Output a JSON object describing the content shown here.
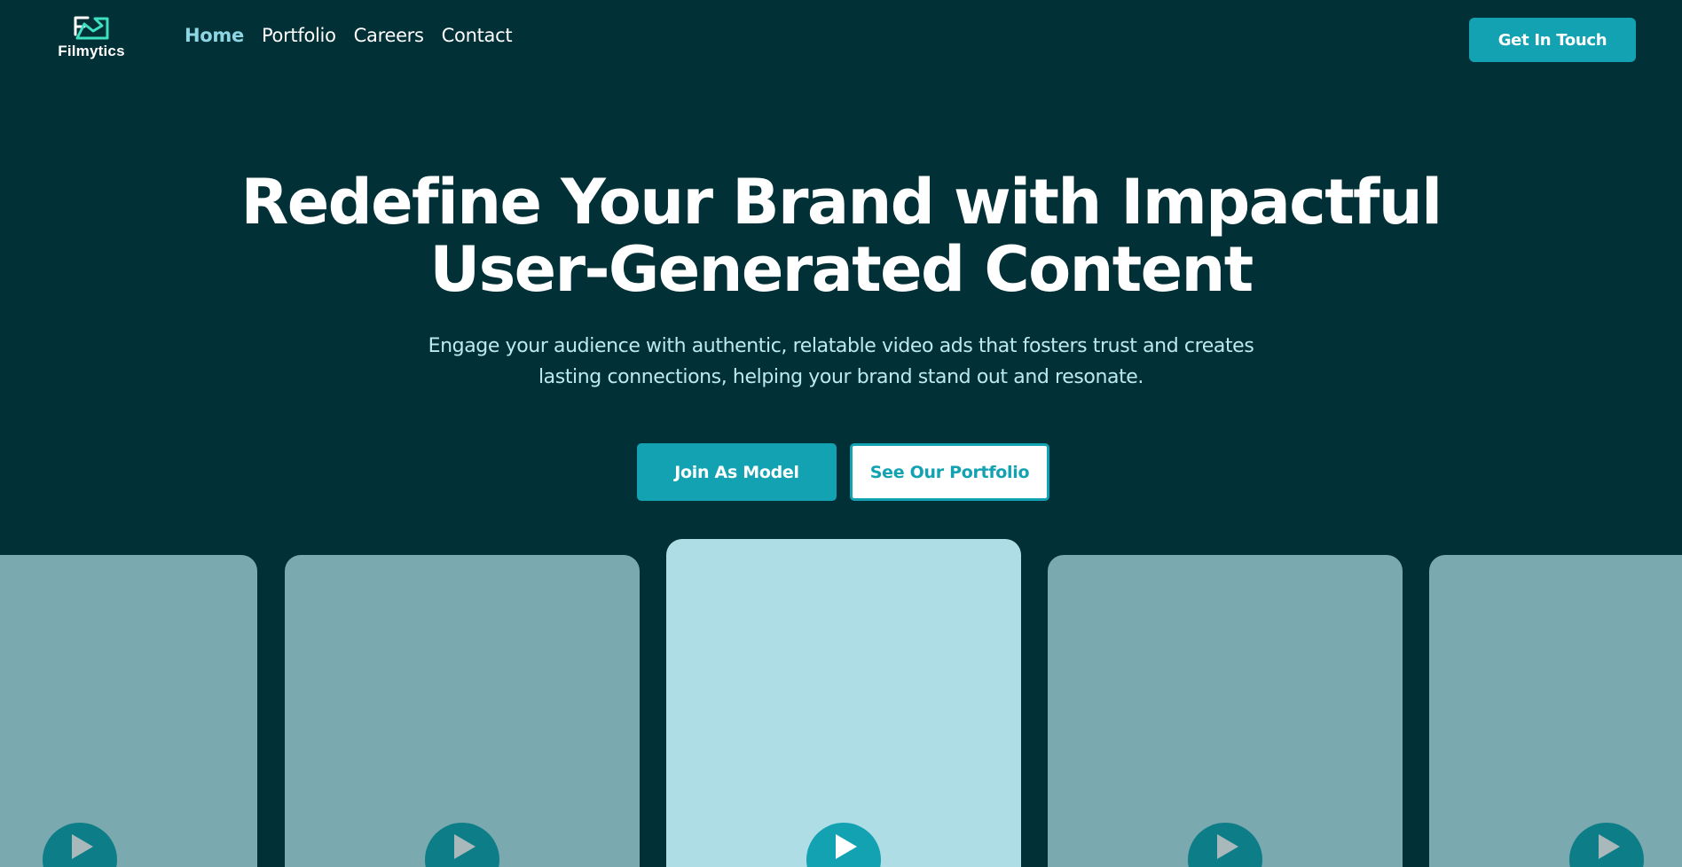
{
  "brand": {
    "name": "Filmytics",
    "logo_icon": "filmytics-logo-icon",
    "accent_color": "#12a2b1",
    "background_color": "#013036"
  },
  "nav": {
    "items": [
      {
        "label": "Home",
        "active": true
      },
      {
        "label": "Portfolio",
        "active": false
      },
      {
        "label": "Careers",
        "active": false
      },
      {
        "label": "Contact",
        "active": false
      }
    ],
    "cta_label": "Get In Touch"
  },
  "hero": {
    "title_line1": "Redefine Your Brand with Impactful",
    "title_line2": "User-Generated Content",
    "subtitle_line1": "Engage your audience with authentic, relatable video ads that fosters trust and creates",
    "subtitle_line2": "lasting connections, helping your brand stand out and resonate.",
    "primary_button": "Join As Model",
    "secondary_button": "See Our Portfolio"
  },
  "videos": {
    "play_icon": "play-icon",
    "cards": [
      {
        "highlighted": false
      },
      {
        "highlighted": false
      },
      {
        "highlighted": true
      },
      {
        "highlighted": false
      },
      {
        "highlighted": false
      }
    ]
  }
}
